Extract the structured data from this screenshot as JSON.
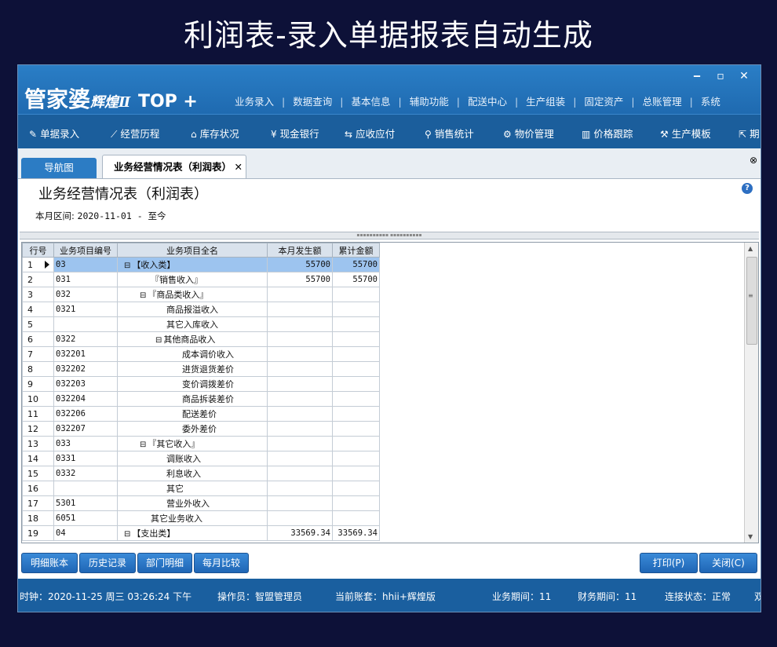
{
  "banner": "利润表-录入单据报表自动生成",
  "app": {
    "logo_main": "管家婆",
    "logo_sub": "辉煌Ⅱ",
    "logo_top": "TOP +",
    "menu": [
      "业务录入",
      "数据查询",
      "基本信息",
      "辅助功能",
      "配送中心",
      "生产组装",
      "固定资产",
      "总账管理",
      "系统"
    ],
    "window_controls": {
      "minimize": "‒",
      "maximize": "▫",
      "close": "✕"
    }
  },
  "toolbar": [
    {
      "label": "单据录入",
      "icon": "edit-doc-icon",
      "glyph": "✎"
    },
    {
      "label": "经营历程",
      "icon": "trend-chart-icon",
      "glyph": "⟋"
    },
    {
      "label": "库存状况",
      "icon": "warehouse-icon",
      "glyph": "⌂"
    },
    {
      "label": "现金银行",
      "icon": "yen-icon",
      "glyph": "¥"
    },
    {
      "label": "应收应付",
      "icon": "exchange-arrows-icon",
      "glyph": "⇆"
    },
    {
      "label": "销售统计",
      "icon": "search-icon",
      "glyph": "⚲"
    },
    {
      "label": "物价管理",
      "icon": "gear-icon",
      "glyph": "⚙"
    },
    {
      "label": "价格跟踪",
      "icon": "bar-chart-icon",
      "glyph": "▥"
    },
    {
      "label": "生产模板",
      "icon": "wrench-icon",
      "glyph": "⚒"
    },
    {
      "label": "期",
      "icon": "export-icon",
      "glyph": "⇱"
    }
  ],
  "tabs": {
    "nav": "导航图",
    "active": "业务经营情况表（利润表）",
    "close": "✕",
    "close_all": "⊗"
  },
  "report": {
    "title": "业务经营情况表（利润表）",
    "period_label": "本月区间:",
    "period_value": "2020-11-01 - 至今",
    "help": "?"
  },
  "grid": {
    "headers": [
      "行号",
      "业务项目编号",
      "业务项目全名",
      "本月发生额",
      "累计金额"
    ],
    "rows": [
      {
        "no": "1",
        "code": "03",
        "name": "【收入类】",
        "tree": "⊟",
        "indent": 0,
        "month": "55700",
        "total": "55700",
        "selected": true
      },
      {
        "no": "2",
        "code": "031",
        "name": "『销售收入』",
        "tree": "",
        "indent": 1,
        "month": "55700",
        "total": "55700"
      },
      {
        "no": "3",
        "code": "032",
        "name": "『商品类收入』",
        "tree": "⊟",
        "indent": 1,
        "month": "",
        "total": ""
      },
      {
        "no": "4",
        "code": "0321",
        "name": "商品报溢收入",
        "tree": "",
        "indent": 2,
        "month": "",
        "total": ""
      },
      {
        "no": "5",
        "code": "",
        "name": "其它入库收入",
        "tree": "",
        "indent": 2,
        "month": "",
        "total": ""
      },
      {
        "no": "6",
        "code": "0322",
        "name": "其他商品收入",
        "tree": "⊟",
        "indent": 2,
        "month": "",
        "total": ""
      },
      {
        "no": "7",
        "code": "032201",
        "name": "成本调价收入",
        "tree": "",
        "indent": 3,
        "month": "",
        "total": ""
      },
      {
        "no": "8",
        "code": "032202",
        "name": "进货退货差价",
        "tree": "",
        "indent": 3,
        "month": "",
        "total": ""
      },
      {
        "no": "9",
        "code": "032203",
        "name": "变价调拨差价",
        "tree": "",
        "indent": 3,
        "month": "",
        "total": ""
      },
      {
        "no": "10",
        "code": "032204",
        "name": "商品拆装差价",
        "tree": "",
        "indent": 3,
        "month": "",
        "total": ""
      },
      {
        "no": "11",
        "code": "032206",
        "name": "配送差价",
        "tree": "",
        "indent": 3,
        "month": "",
        "total": ""
      },
      {
        "no": "12",
        "code": "032207",
        "name": "委外差价",
        "tree": "",
        "indent": 3,
        "month": "",
        "total": ""
      },
      {
        "no": "13",
        "code": "033",
        "name": "『其它收入』",
        "tree": "⊟",
        "indent": 1,
        "month": "",
        "total": ""
      },
      {
        "no": "14",
        "code": "0331",
        "name": "调账收入",
        "tree": "",
        "indent": 2,
        "month": "",
        "total": ""
      },
      {
        "no": "15",
        "code": "0332",
        "name": "利息收入",
        "tree": "",
        "indent": 2,
        "month": "",
        "total": ""
      },
      {
        "no": "16",
        "code": "",
        "name": "其它",
        "tree": "",
        "indent": 2,
        "month": "",
        "total": ""
      },
      {
        "no": "17",
        "code": "5301",
        "name": "营业外收入",
        "tree": "",
        "indent": 2,
        "month": "",
        "total": ""
      },
      {
        "no": "18",
        "code": "6051",
        "name": "其它业务收入",
        "tree": "",
        "indent": 1,
        "month": "",
        "total": ""
      },
      {
        "no": "19",
        "code": "04",
        "name": "【支出类】",
        "tree": "⊟",
        "indent": 0,
        "month": "33569.34",
        "total": "33569.34"
      }
    ]
  },
  "buttons": {
    "detail": "明细账本",
    "history": "历史记录",
    "dept": "部门明细",
    "monthly": "每月比较",
    "print": "打印(P)",
    "close": "关闭(C)"
  },
  "status": {
    "clock": "时钟：2020-11-25 周三 03:26:24 下午",
    "operator": "操作员：智盟管理员",
    "account": "当前账套：hhii+辉煌版",
    "biz_period": "业务期间：11",
    "fin_period": "财务期间：11",
    "conn": "连接状态：正常",
    "extra": "双"
  }
}
